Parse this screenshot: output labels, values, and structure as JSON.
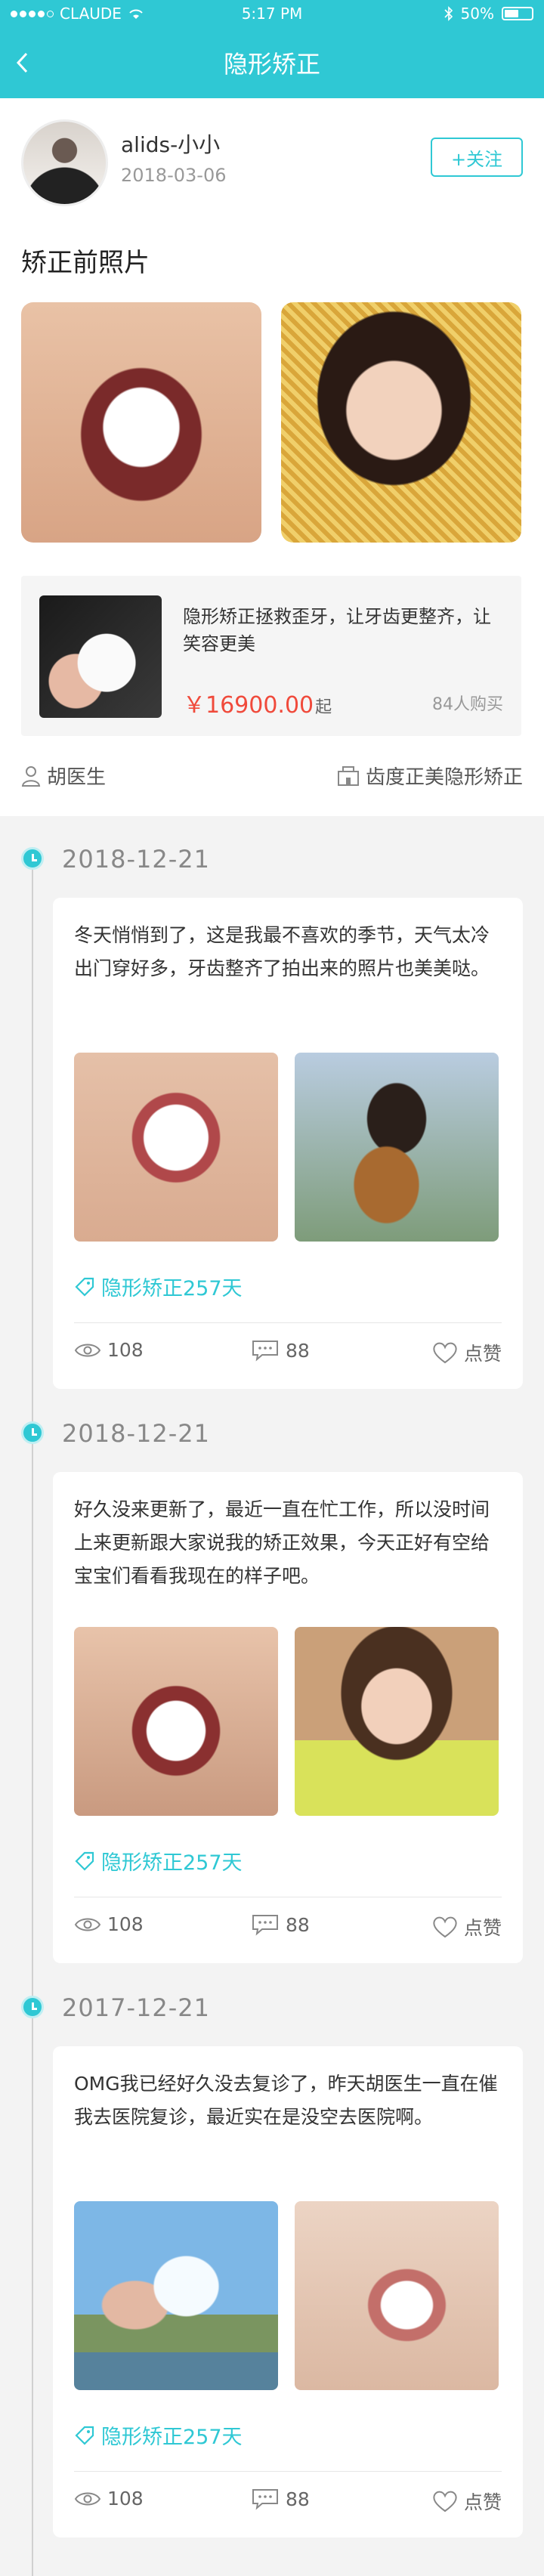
{
  "status_bar": {
    "carrier": "CLAUDE",
    "time": "5:17 PM",
    "battery": "50%"
  },
  "nav": {
    "title": "隐形矫正"
  },
  "profile": {
    "username": "alids-小小",
    "date": "2018-03-06",
    "follow_label": "+关注"
  },
  "before_section": {
    "title": "矫正前照片"
  },
  "product": {
    "description": "隐形矫正拯救歪牙，让牙齿更整齐，让笑容更美",
    "price": "￥16900.00",
    "price_suffix": "起",
    "buyers": "84人购买"
  },
  "doctor": {
    "name": "胡医生"
  },
  "clinic": {
    "name": "齿度正美隐形矫正"
  },
  "timeline": [
    {
      "date": "2018-12-21",
      "text": "冬天悄悄到了，这是我最不喜欢的季节，天气太冷出门穿好多，牙齿整齐了拍出来的照片也美美哒。",
      "tag": "隐形矫正257天",
      "views": "108",
      "comments": "88",
      "like_label": "点赞"
    },
    {
      "date": "2018-12-21",
      "text": "好久没来更新了，最近一直在忙工作，所以没时间上来更新跟大家说我的矫正效果，今天正好有空给宝宝们看看我现在的样子吧。",
      "tag": "隐形矫正257天",
      "views": "108",
      "comments": "88",
      "like_label": "点赞"
    },
    {
      "date": "2017-12-21",
      "text": "OMG我已经好久没去复诊了，昨天胡医生一直在催我去医院复诊，最近实在是没空去医院啊。",
      "tag": "隐形矫正257天",
      "views": "108",
      "comments": "88",
      "like_label": "点赞"
    }
  ],
  "colors": {
    "accent": "#2fc8d4",
    "price": "#f04a3b"
  }
}
